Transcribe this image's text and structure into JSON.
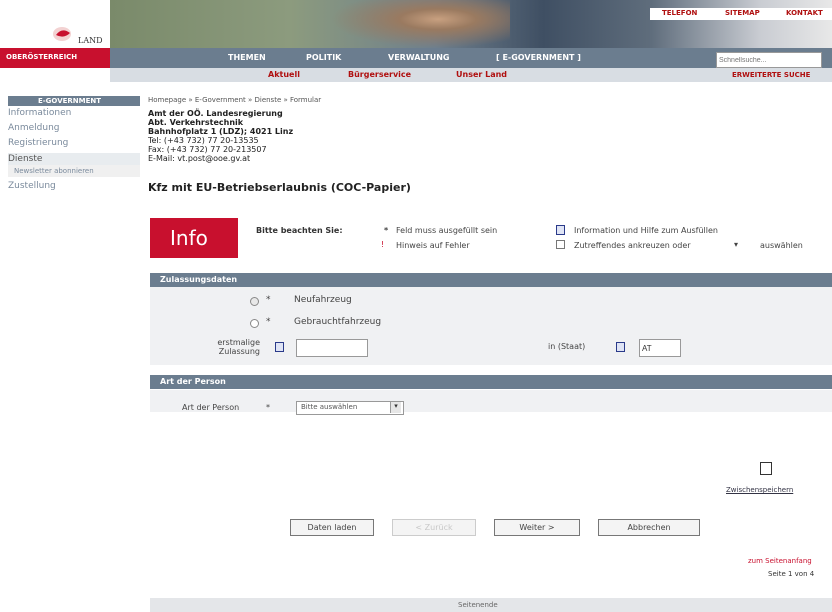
{
  "header": {
    "logo_small": "LAND",
    "state_name": "OBERÖSTERREICH",
    "top_links": [
      "TELEFON",
      "SITEMAP",
      "KONTAKT"
    ]
  },
  "nav": {
    "items": [
      "THEMEN",
      "POLITIK",
      "VERWALTUNG",
      "[ E-GOVERNMENT ]"
    ],
    "search_placeholder": "Schnellsuche...",
    "advanced_search": "ERWEITERTE SUCHE"
  },
  "subnav": {
    "items": [
      "Aktuell",
      "Bürgerservice",
      "Unser Land"
    ]
  },
  "sidebar": {
    "title": "E-GOVERNMENT",
    "items": [
      "Informationen",
      "Anmeldung",
      "Registrierung",
      "Dienste",
      "Newsletter abonnieren",
      "Zustellung"
    ]
  },
  "breadcrumb": "Homepage » E-Government » Dienste » Formular",
  "address": {
    "line1": "Amt der OÖ. Landesregierung",
    "line2": "Abt. Verkehrstechnik",
    "line3": "Bahnhofplatz 1 (LDZ); 4021 Linz",
    "line4": "Tel: (+43 732) 77 20-13535",
    "line5": "Fax: (+43 732) 77 20-213507",
    "line6": "E-Mail: vt.post@ooe.gv.at"
  },
  "page_title": "Kfz mit EU-Betriebserlaubnis (COC-Papier)",
  "info": {
    "badge": "Info",
    "label": "Bitte beachten Sie:",
    "required": "Feld muss ausgefüllt sein",
    "error_hint": "Hinweis auf Fehler",
    "help_hint": "Information und Hilfe zum Ausfüllen",
    "check_hint_1": "Zutreffendes ankreuzen oder",
    "check_hint_2": "auswählen"
  },
  "zulassung": {
    "section_title": "Zulassungsdaten",
    "option_new": "Neufahrzeug",
    "option_used": "Gebrauchtfahrzeug",
    "first_reg_label_1": "erstmalige",
    "first_reg_label_2": "Zulassung",
    "state_label": "in (Staat)",
    "state_value": "AT"
  },
  "person": {
    "section_title": "Art der Person",
    "field_label": "Art der Person",
    "select_value": "Bitte auswählen"
  },
  "buttons": {
    "load": "Daten laden",
    "back": "< Zurück",
    "next": "Weiter >",
    "cancel": "Abbrechen"
  },
  "save_label": "Zwischenspeichern",
  "to_top": "zum Seitenanfang",
  "page_of": "Seite 1 von 4",
  "footer": "Seitenende"
}
